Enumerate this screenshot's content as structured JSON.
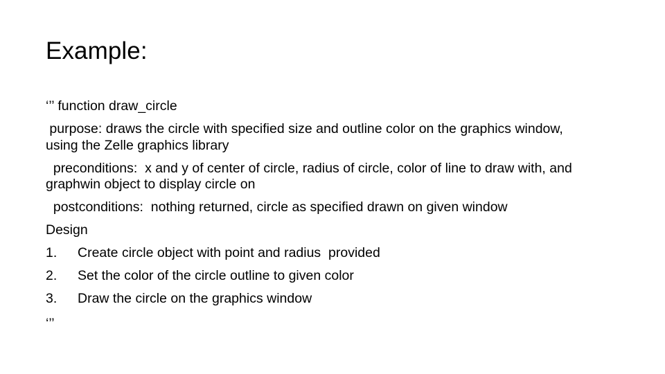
{
  "slide": {
    "background_color": "#ffffff",
    "text_color": "#000000",
    "title": "Example:",
    "body": {
      "docstring_open": "‘’’ function draw_circle",
      "purpose": " purpose: draws the circle with specified size and outline color on the graphics window, using the Zelle graphics library",
      "preconditions": "  preconditions:  x and y of center of circle, radius of circle, color of line to draw with, and graphwin object to display circle on",
      "postconditions": "  postconditions:  nothing returned, circle as specified drawn on given window",
      "design_heading": "Design",
      "steps": [
        {
          "marker": "1.",
          "text": "Create circle object with point and radius  provided"
        },
        {
          "marker": "2.",
          "text": "Set the color of the circle outline to given color"
        },
        {
          "marker": "3.",
          "text": "Draw the circle on the graphics window"
        }
      ],
      "docstring_close": "‘’’"
    }
  }
}
